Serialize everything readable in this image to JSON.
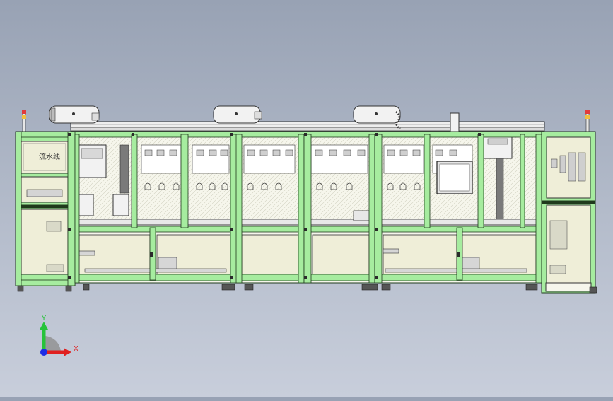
{
  "viewport": {
    "background_top": "#98a2b4",
    "background_bottom": "#c8cedb",
    "model_label": "流水线"
  },
  "colors": {
    "frame_green": "#a6ec9f",
    "frame_edge": "#1f3a1c",
    "panel_cream": "#efeed8",
    "line_dark": "#2a2a2a",
    "signal_red": "#e23b3b",
    "axis_x": "#e02020",
    "axis_y": "#27c33a",
    "axis_z": "#1d2de6"
  },
  "triad": {
    "x_label": "X",
    "y_label": "Y",
    "icons": [
      "axis-x-arrow-icon",
      "axis-y-arrow-icon",
      "axis-z-dot-icon"
    ]
  }
}
